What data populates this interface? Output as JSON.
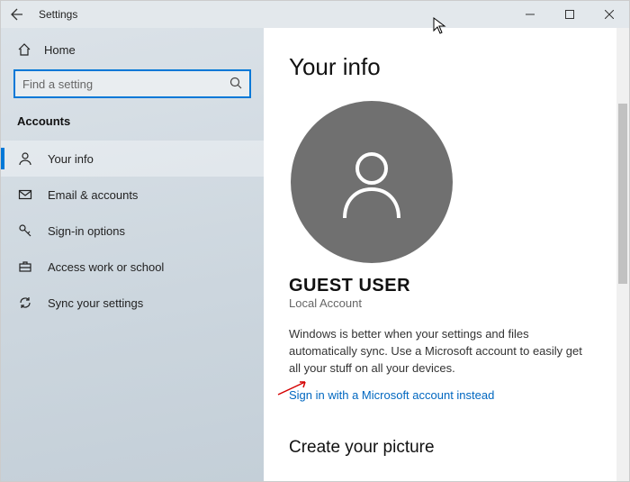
{
  "titlebar": {
    "title": "Settings"
  },
  "sidebar": {
    "home": "Home",
    "search_placeholder": "Find a setting",
    "section": "Accounts",
    "items": [
      {
        "label": "Your info"
      },
      {
        "label": "Email & accounts"
      },
      {
        "label": "Sign-in options"
      },
      {
        "label": "Access work or school"
      },
      {
        "label": "Sync your settings"
      }
    ]
  },
  "main": {
    "heading": "Your info",
    "username": "GUEST USER",
    "account_type": "Local Account",
    "description": "Windows is better when your settings and files automatically sync. Use a Microsoft account to easily get all your stuff on all your devices.",
    "signin_link": "Sign in with a Microsoft account instead",
    "picture_heading": "Create your picture"
  }
}
